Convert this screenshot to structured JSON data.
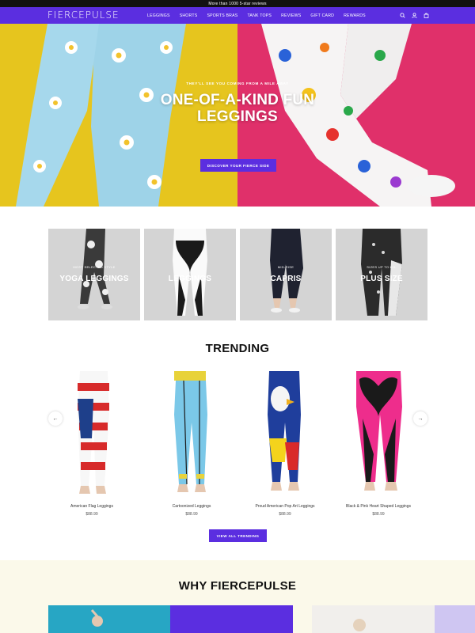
{
  "announcement": "More than 1000 5-star reviews",
  "header": {
    "logo": "FIERCEPULSE",
    "nav": [
      "LEGGINGS",
      "SHORTS",
      "SPORTS BRAS",
      "TANK TOPS",
      "REVIEWS",
      "GIFT CARD",
      "REWARDS"
    ],
    "icons": [
      "search-icon",
      "account-icon",
      "cart-icon"
    ]
  },
  "hero": {
    "subtitle": "THEY'LL SEE YOU COMING FROM A MILE AWAY",
    "title": "ONE-OF-A-KIND FUN LEGGINGS",
    "button": "DISCOVER YOUR FIERCE SIDE",
    "left_color": "#e6c51e",
    "right_color": "#e0306a"
  },
  "categories": [
    {
      "small": "MOST SELECTED STYLE",
      "label": "YOGA LEGGINGS"
    },
    {
      "small": "",
      "label": "LEGGINGS"
    },
    {
      "small": "MID-RISE",
      "label": "CAPRIS"
    },
    {
      "small": "SIZES UP TO 6XL",
      "label": "PLUS SIZE"
    }
  ],
  "trending": {
    "title": "TRENDING",
    "products": [
      {
        "name": "American Flag Leggings",
        "price": "$88.99"
      },
      {
        "name": "Cartoonized Leggings",
        "price": "$88.99"
      },
      {
        "name": "Proud American Pop Art Leggings",
        "price": "$88.99"
      },
      {
        "name": "Black & Pink Heart Shaped Leggings",
        "price": "$88.99"
      }
    ],
    "view_all": "VIEW ALL TRENDING",
    "prev_icon": "arrow-left-icon",
    "next_icon": "arrow-right-icon"
  },
  "why": {
    "title": "WHY FIERCEPULSE"
  },
  "colors": {
    "brand": "#5b2ee0"
  }
}
